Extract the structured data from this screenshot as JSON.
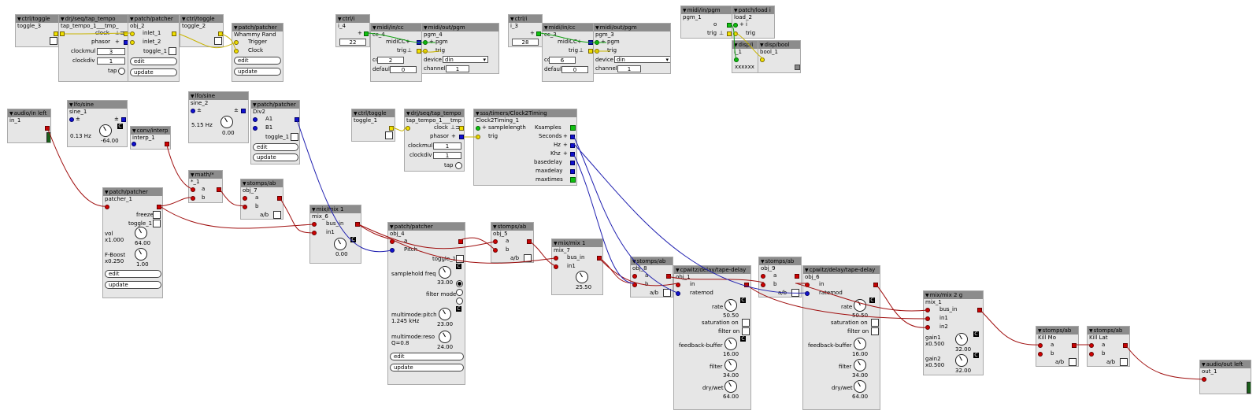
{
  "objects": [
    {
      "title": "ctrl/toggle",
      "inst": "toggle_3"
    },
    {
      "title": "drj/seq/tap_tempo",
      "inst": "tap_tempo_1___tmp_",
      "labels": {
        "clock": "clock",
        "phasor": "phasor",
        "clockmul": "clockmul",
        "clockdiv": "clockdiv",
        "tap": "tap"
      },
      "values": {
        "clockmul": "3",
        "clockdiv": "1"
      }
    },
    {
      "title": "patch/patcher",
      "inst": "obj_2",
      "labels": {
        "inlet_1": "inlet_1",
        "inlet_2": "inlet_2",
        "toggle_1": "toggle_1"
      },
      "edit": "edit",
      "update": "update"
    },
    {
      "title": "ctrl/toggle",
      "inst": "toggle_2"
    },
    {
      "title": "patch/patcher",
      "inst": "Whammy Rand",
      "labels": {
        "trigger": "Trigger",
        "clock": "Clock"
      },
      "edit": "edit",
      "update": "update"
    },
    {
      "title": "ctrl/i",
      "inst": "i_4",
      "value": "22"
    },
    {
      "title": "midi/in/cc",
      "inst": "cc_4",
      "labels": {
        "midicc": "midiCC",
        "trig": "trig",
        "cc": "cc",
        "default": "default"
      },
      "values": {
        "cc": "2",
        "default": "0"
      }
    },
    {
      "title": "midi/out/pgm",
      "inst": "pgm_4",
      "labels": {
        "pgm": "pgm",
        "trig": "trig",
        "device": "device",
        "channel": "channel"
      },
      "values": {
        "device": "din",
        "channel": "1"
      }
    },
    {
      "title": "ctrl/i",
      "inst": "i_3",
      "value": "28"
    },
    {
      "title": "midi/in/cc",
      "inst": "cc_3",
      "labels": {
        "midicc": "midiCC",
        "trig": "trig",
        "cc": "cc",
        "default": "default"
      },
      "values": {
        "cc": "6",
        "default": "0"
      }
    },
    {
      "title": "midi/out/pgm",
      "inst": "pgm_3",
      "labels": {
        "pgm": "pgm",
        "trig": "trig",
        "device": "device",
        "channel": "channel"
      },
      "values": {
        "device": "din",
        "channel": "1"
      }
    },
    {
      "title": "midi/in/pgm",
      "inst": "pgm_1",
      "labels": {
        "o": "o",
        "trig": "trig"
      }
    },
    {
      "title": "patch/load i",
      "inst": "load_2",
      "labels": {
        "i": "i",
        "trig": "trig"
      }
    },
    {
      "title": "disp/i",
      "inst": "i_1",
      "value": "xxxxxx"
    },
    {
      "title": "disp/bool",
      "inst": "bool_1"
    },
    {
      "title": "audio/in left",
      "inst": "in_1"
    },
    {
      "title": "lfo/sine",
      "inst": "sine_1",
      "freq": "0.13 Hz",
      "knob": "-64.00"
    },
    {
      "title": "conv/interp",
      "inst": "interp_1"
    },
    {
      "title": "lfo/sine",
      "inst": "sine_2",
      "freq": "5.15 Hz",
      "knob": "0.00"
    },
    {
      "title": "patch/patcher",
      "inst": "Div2",
      "labels": {
        "a1": "A1",
        "b1": "B1",
        "toggle_1": "toggle_1"
      },
      "edit": "edit",
      "update": "update"
    },
    {
      "title": "math/*",
      "inst": "*_1",
      "labels": {
        "a": "a",
        "b": "b"
      }
    },
    {
      "title": "stomps/ab",
      "inst": "obj_7",
      "labels": {
        "a": "a",
        "b": "b",
        "ab": "a/b"
      }
    },
    {
      "title": "patch/patcher",
      "inst": "patcher_1",
      "labels": {
        "freeze": "freeze",
        "toggle_1": "toggle_1",
        "vol": "vol",
        "vol_mul": "x1.000",
        "fboost": "F-Boost",
        "fboost_mul": "x0.250"
      },
      "knobs": {
        "vol": "64.00",
        "fboost": "1.00"
      },
      "edit": "edit",
      "update": "update"
    },
    {
      "title": "mix/mix 1",
      "inst": "mix_6",
      "labels": {
        "bus_in": "bus_in",
        "in1": "in1"
      },
      "knob": "0.00"
    },
    {
      "title": "ctrl/toggle",
      "inst": "toggle_1"
    },
    {
      "title": "drj/seq/tap_tempo",
      "inst": "tap_tempo_1___tmp",
      "labels": {
        "clock": "clock",
        "phasor": "phasor",
        "clockmul": "clockmul",
        "clockdiv": "clockdiv",
        "tap": "tap"
      },
      "values": {
        "clockmul": "1",
        "clockdiv": "1"
      }
    },
    {
      "title": "sss/timers/Clock2Timing",
      "inst": "Clock2Timing_1",
      "labels": {
        "samplelength": "samplelength",
        "trig": "trig",
        "ksamples": "Ksamples",
        "seconds": "Seconds",
        "hz": "Hz",
        "khz": "Khz",
        "basedelay": "basedelay",
        "maxdelay": "maxdelay",
        "maxtimes": "maxtimes"
      }
    },
    {
      "title": "patch/patcher",
      "inst": "obj_4",
      "labels": {
        "a": "a",
        "pitch": "Pitch",
        "toggle_1": "toggle_1",
        "samplehold": "samplehold freq",
        "filtermode": "filter mode",
        "mmpitch": "multimode:pitch",
        "mmpitch_val": "1.245 kHz",
        "mmreso": "multimode:reso",
        "mmreso_val": "Q=0.8"
      },
      "knobs": {
        "samplehold": "33.00",
        "mmpitch": "23.00",
        "mmreso": "24.00"
      },
      "edit": "edit",
      "update": "update"
    },
    {
      "title": "stomps/ab",
      "inst": "obj_5",
      "labels": {
        "a": "a",
        "b": "b",
        "ab": "a/b"
      }
    },
    {
      "title": "mix/mix 1",
      "inst": "mix_7",
      "labels": {
        "bus_in": "bus_in",
        "in1": "in1"
      },
      "knob": "25.50"
    },
    {
      "title": "stomps/ab",
      "inst": "obj_8",
      "labels": {
        "a": "a",
        "b": "b",
        "ab": "a/b"
      }
    },
    {
      "title": "cpwitz/delay/tape-delay",
      "inst": "obj_1",
      "labels": {
        "in": "in",
        "ratemod": "ratemod",
        "rate": "rate",
        "saturation": "saturation on",
        "filter": "filter on",
        "feedback": "feedback-buffer",
        "filt": "filter",
        "drywet": "dry/wet"
      },
      "knobs": {
        "rate": "50.50",
        "feedback": "16.00",
        "filt": "34.00",
        "drywet": "64.00"
      }
    },
    {
      "title": "stomps/ab",
      "inst": "obj_9",
      "labels": {
        "a": "a",
        "b": "b",
        "ab": "a/b"
      }
    },
    {
      "title": "cpwitz/delay/tape-delay",
      "inst": "obj_6",
      "labels": {
        "in": "in",
        "ratemod": "ratemod",
        "rate": "rate",
        "saturation": "saturation on",
        "filter": "filter on",
        "feedback": "feedback-buffer",
        "filt": "filter",
        "drywet": "dry/wet"
      },
      "knobs": {
        "rate": "50.50",
        "feedback": "16.00",
        "filt": "34.00",
        "drywet": "64.00"
      }
    },
    {
      "title": "mix/mix 2 g",
      "inst": "mix_1",
      "labels": {
        "bus_in": "bus_in",
        "in1": "in1",
        "in2": "in2",
        "gain1": "gain1",
        "gain1_mul": "x0.500",
        "gain2": "gain2",
        "gain2_mul": "x0.500"
      },
      "knobs": {
        "gain1": "32.00",
        "gain2": "32.00"
      }
    },
    {
      "title": "stomps/ab",
      "inst": "Kill Mo",
      "labels": {
        "a": "a",
        "b": "b",
        "ab": "a/b"
      }
    },
    {
      "title": "stomps/ab",
      "inst": "Kill Lat",
      "labels": {
        "a": "a",
        "b": "b",
        "ab": "a/b"
      }
    },
    {
      "title": "audio/out left",
      "inst": "out_1"
    }
  ],
  "symbols": {
    "pm": "±",
    "plus": "+",
    "c": "C",
    "dd": "▾",
    "tri": "▼"
  },
  "colors": {
    "audio": "#a01010",
    "frac": "#1010d0",
    "bool": "#d0c000",
    "int": "#10b010",
    "header": "#8c8c8c",
    "panel": "#e6e6e6"
  }
}
